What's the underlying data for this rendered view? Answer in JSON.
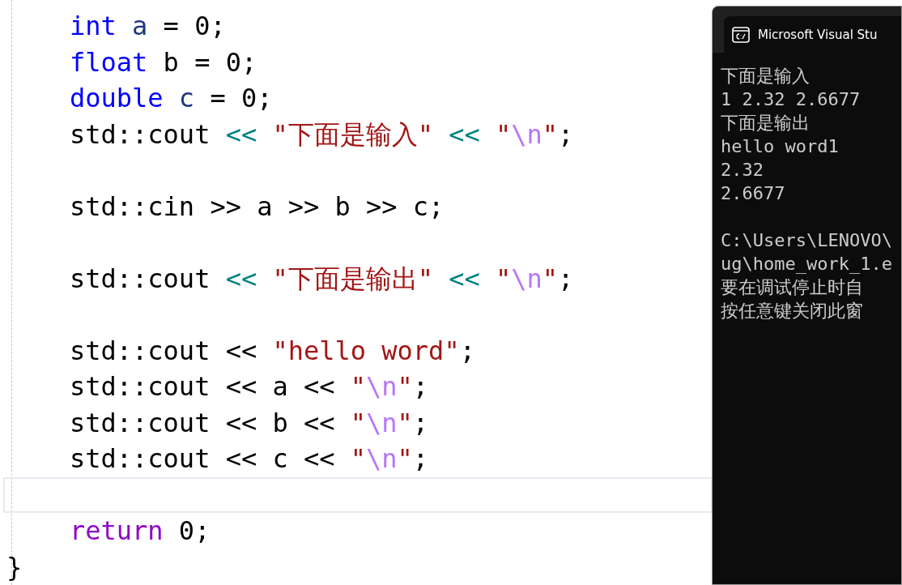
{
  "editor": {
    "lines": [
      {
        "kind": "code",
        "current": false,
        "tokens": [
          {
            "kind": "keyword",
            "text": "int"
          },
          {
            "kind": "variable",
            "text": " a"
          },
          {
            "kind": "plain",
            "text": " = 0;"
          }
        ]
      },
      {
        "kind": "code",
        "current": false,
        "tokens": [
          {
            "kind": "keyword",
            "text": "float"
          },
          {
            "kind": "plain",
            "text": " b = 0;"
          }
        ]
      },
      {
        "kind": "code",
        "current": false,
        "tokens": [
          {
            "kind": "keyword",
            "text": "double"
          },
          {
            "kind": "variable",
            "text": " c"
          },
          {
            "kind": "plain",
            "text": " = 0;"
          }
        ]
      },
      {
        "kind": "code",
        "current": false,
        "tokens": [
          {
            "kind": "plain",
            "text": "std::cout "
          },
          {
            "kind": "operator",
            "text": "<<"
          },
          {
            "kind": "string",
            "text": " \"下面是输入\""
          },
          {
            "kind": "operator",
            "text": " <<"
          },
          {
            "kind": "string",
            "text": " \""
          },
          {
            "kind": "escape",
            "text": "\\n"
          },
          {
            "kind": "string",
            "text": "\""
          },
          {
            "kind": "plain",
            "text": ";"
          }
        ]
      },
      {
        "kind": "blank",
        "current": false
      },
      {
        "kind": "code",
        "current": false,
        "tokens": [
          {
            "kind": "plain",
            "text": "std::cin >> a >> b >> c;"
          }
        ]
      },
      {
        "kind": "blank",
        "current": false
      },
      {
        "kind": "code",
        "current": false,
        "tokens": [
          {
            "kind": "plain",
            "text": "std::cout "
          },
          {
            "kind": "operator",
            "text": "<<"
          },
          {
            "kind": "string",
            "text": " \"下面是输出\""
          },
          {
            "kind": "operator",
            "text": " <<"
          },
          {
            "kind": "string",
            "text": " \""
          },
          {
            "kind": "escape",
            "text": "\\n"
          },
          {
            "kind": "string",
            "text": "\""
          },
          {
            "kind": "plain",
            "text": ";"
          }
        ]
      },
      {
        "kind": "blank",
        "current": false
      },
      {
        "kind": "code",
        "current": false,
        "tokens": [
          {
            "kind": "plain",
            "text": "std::cout << "
          },
          {
            "kind": "string",
            "text": "\"hello word\""
          },
          {
            "kind": "plain",
            "text": ";"
          }
        ]
      },
      {
        "kind": "code",
        "current": false,
        "tokens": [
          {
            "kind": "plain",
            "text": "std::cout << a << "
          },
          {
            "kind": "string",
            "text": "\""
          },
          {
            "kind": "escape",
            "text": "\\n"
          },
          {
            "kind": "string",
            "text": "\""
          },
          {
            "kind": "plain",
            "text": ";"
          }
        ]
      },
      {
        "kind": "code",
        "current": false,
        "tokens": [
          {
            "kind": "plain",
            "text": "std::cout << b << "
          },
          {
            "kind": "string",
            "text": "\""
          },
          {
            "kind": "escape",
            "text": "\\n"
          },
          {
            "kind": "string",
            "text": "\""
          },
          {
            "kind": "plain",
            "text": ";"
          }
        ]
      },
      {
        "kind": "code",
        "current": false,
        "tokens": [
          {
            "kind": "plain",
            "text": "std::cout << c << "
          },
          {
            "kind": "string",
            "text": "\""
          },
          {
            "kind": "escape",
            "text": "\\n"
          },
          {
            "kind": "string",
            "text": "\""
          },
          {
            "kind": "plain",
            "text": ";"
          }
        ]
      },
      {
        "kind": "blank",
        "current": true
      },
      {
        "kind": "code",
        "current": false,
        "tokens": [
          {
            "kind": "control",
            "text": "return"
          },
          {
            "kind": "plain",
            "text": " 0;"
          }
        ]
      },
      {
        "kind": "closing",
        "current": false,
        "tokens": [
          {
            "kind": "plain",
            "text": "}"
          }
        ]
      }
    ]
  },
  "console": {
    "title": "Microsoft Visual Stu",
    "blocks": [
      [
        "下面是输入",
        "1 2.32 2.6677",
        "下面是输出",
        "hello word1",
        "2.32",
        "2.6677"
      ],
      [
        "C:\\Users\\LENOVO\\",
        "ug\\home_work_1.e",
        "要在调试停止时自",
        "按任意键关闭此窗"
      ]
    ]
  }
}
